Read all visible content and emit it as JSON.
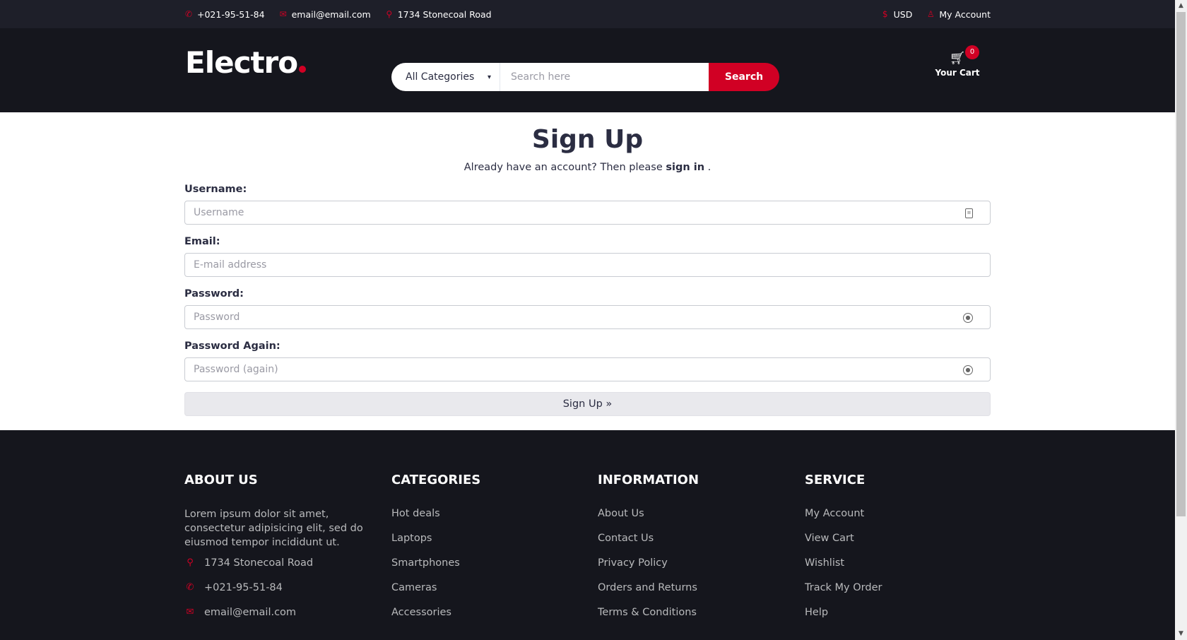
{
  "topbar": {
    "phone": "+021-95-51-84",
    "email": "email@email.com",
    "address": "1734 Stonecoal Road",
    "currency": "USD",
    "account": "My Account"
  },
  "header": {
    "logo": "Electro",
    "search": {
      "category": "All Categories",
      "placeholder": "Search here",
      "button": "Search"
    },
    "cart": {
      "label": "Your Cart",
      "count": "0"
    }
  },
  "form": {
    "title": "Sign Up",
    "subtitle_prefix": "Already have an account? Then please ",
    "signin_link": "sign in",
    "subtitle_suffix": " .",
    "username": {
      "label": "Username:",
      "placeholder": "Username"
    },
    "email": {
      "label": "Email:",
      "placeholder": "E-mail address"
    },
    "password": {
      "label": "Password:",
      "placeholder": "Password"
    },
    "password2": {
      "label": "Password Again:",
      "placeholder": "Password (again)"
    },
    "submit": "Sign Up »"
  },
  "footer": {
    "about": {
      "title": "ABOUT US",
      "text": "Lorem ipsum dolor sit amet, consectetur adipisicing elit, sed do eiusmod tempor incididunt ut.",
      "address": "1734 Stonecoal Road",
      "phone": "+021-95-51-84",
      "email": "email@email.com"
    },
    "categories": {
      "title": "CATEGORIES",
      "items": [
        "Hot deals",
        "Laptops",
        "Smartphones",
        "Cameras",
        "Accessories"
      ]
    },
    "information": {
      "title": "INFORMATION",
      "items": [
        "About Us",
        "Contact Us",
        "Privacy Policy",
        "Orders and Returns",
        "Terms & Conditions"
      ]
    },
    "service": {
      "title": "SERVICE",
      "items": [
        "My Account",
        "View Cart",
        "Wishlist",
        "Track My Order",
        "Help"
      ]
    }
  },
  "colors": {
    "accent": "#d10024",
    "dark": "#15161d",
    "topbar": "#1e1f29"
  },
  "icons": {
    "phone": "phone-icon",
    "email": "envelope-icon",
    "address": "map-marker-icon",
    "currency": "dollar-icon",
    "account": "user-icon",
    "cart": "shopping-cart-icon"
  }
}
